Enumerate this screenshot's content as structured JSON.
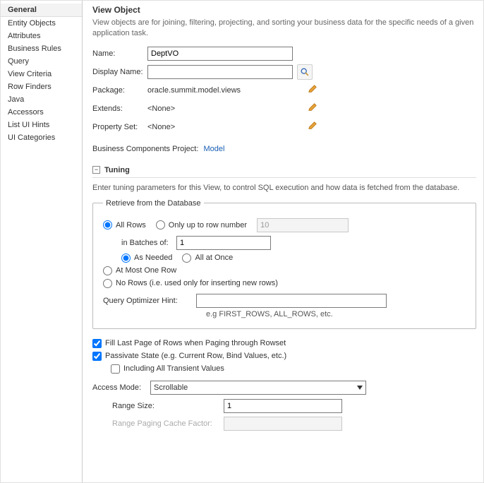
{
  "sidebar": {
    "items": [
      {
        "label": "General",
        "selected": true
      },
      {
        "label": "Entity Objects"
      },
      {
        "label": "Attributes"
      },
      {
        "label": "Business Rules"
      },
      {
        "label": "Query"
      },
      {
        "label": "View Criteria"
      },
      {
        "label": "Row Finders"
      },
      {
        "label": "Java"
      },
      {
        "label": "Accessors"
      },
      {
        "label": "List UI Hints"
      },
      {
        "label": "UI Categories"
      }
    ]
  },
  "header": {
    "title": "View Object",
    "desc": "View objects are for joining, filtering, projecting, and sorting your business data for the specific needs of a given application task."
  },
  "form": {
    "name_label": "Name:",
    "name_value": "DeptVO",
    "display_name_label": "Display Name:",
    "display_name_value": "",
    "package_label": "Package:",
    "package_value": "oracle.summit.model.views",
    "extends_label": "Extends:",
    "extends_value": "<None>",
    "property_set_label": "Property Set:",
    "property_set_value": "<None>",
    "biz_proj_label": "Business Components Project:",
    "biz_proj_value": "Model"
  },
  "tuning": {
    "twisty": "−",
    "title": "Tuning",
    "desc": "Enter tuning parameters for this View, to control SQL execution and how data is fetched from the database.",
    "retrieve_legend": "Retrieve from the Database",
    "all_rows": "All Rows",
    "only_upto": "Only up to row number",
    "row_number_value": "10",
    "in_batches_label": "in Batches of:",
    "in_batches_value": "1",
    "as_needed": "As Needed",
    "all_at_once": "All at Once",
    "at_most_one": "At Most One Row",
    "no_rows": "No Rows (i.e. used only for inserting new rows)",
    "qoh_label": "Query Optimizer Hint:",
    "qoh_value": "",
    "qoh_hint": "e.g FIRST_ROWS, ALL_ROWS, etc.",
    "fill_last": "Fill Last Page of Rows when Paging through Rowset",
    "passivate": "Passivate State (e.g. Current Row, Bind Values, etc.)",
    "incl_transient": "Including All Transient Values",
    "access_mode_label": "Access Mode:",
    "access_mode_value": "Scrollable",
    "range_size_label": "Range Size:",
    "range_size_value": "1",
    "rpcf_label": "Range Paging Cache Factor:",
    "rpcf_value": ""
  }
}
